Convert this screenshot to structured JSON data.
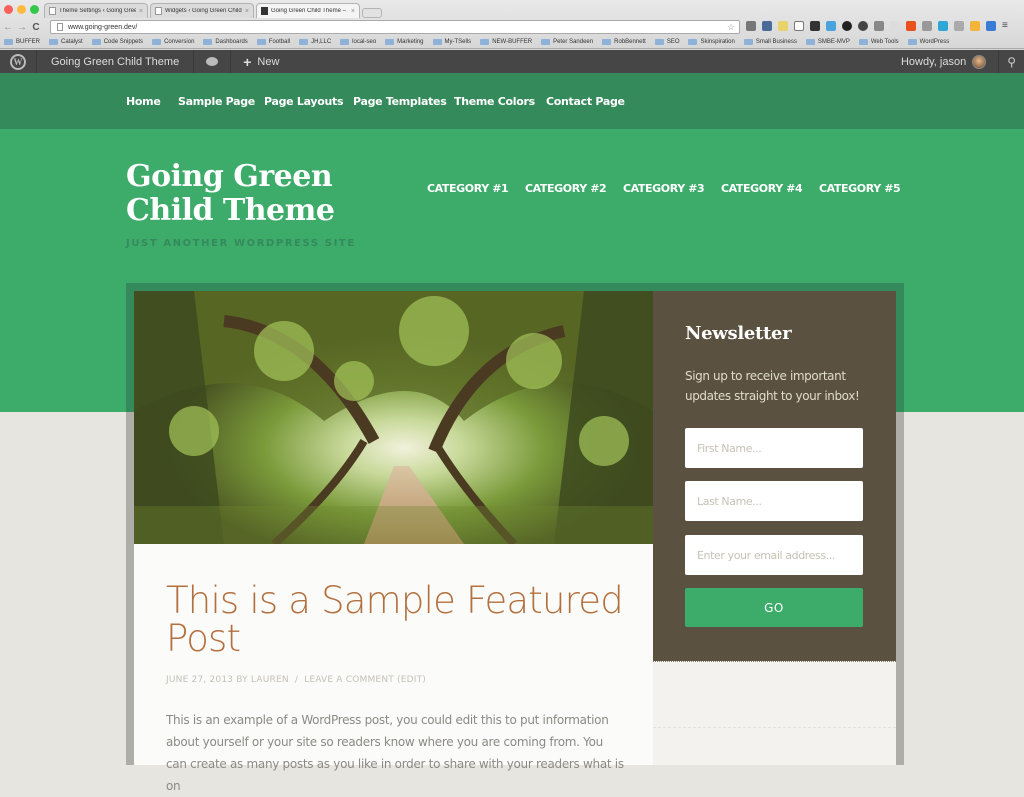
{
  "browser": {
    "tabs": [
      {
        "title": "Theme Settings ‹ Going Green",
        "active": false
      },
      {
        "title": "Widgets ‹ Going Green Child",
        "active": false
      },
      {
        "title": "Going Green Child Theme – J",
        "active": true
      }
    ],
    "url": "www.going-green.dev/",
    "bookmarks": [
      "BUFFER",
      "Catalyst",
      "Code Snippets",
      "Conversion",
      "Dashboards",
      "Football",
      "JH,LLC",
      "local-seo",
      "Marketing",
      "My-TSells",
      "NEW-BUFFER",
      "Peter Sandeen",
      "RobBennett",
      "SEO",
      "Skinspiration",
      "Small Business",
      "SMBE-MVP",
      "Web Tools",
      "WordPress"
    ],
    "extension_icons": [
      "wrench-icon",
      "weather-icon",
      "note-icon",
      "font-icon",
      "layers-icon",
      "feather-icon",
      "circle-icon",
      "gear-icon",
      "cloud-icon",
      "page-icon",
      "k-icon",
      "qr-icon",
      "m-icon",
      "sprout-icon",
      "duck-icon",
      "w-icon"
    ],
    "close_glyph": "×"
  },
  "adminbar": {
    "site_name": "Going Green Child Theme",
    "new_label": "New",
    "greeting": "Howdy, jason"
  },
  "nav": {
    "primary": [
      "Home",
      "Sample Page",
      "Page Layouts",
      "Page Templates",
      "Theme Colors",
      "Contact Page"
    ],
    "categories": [
      "CATEGORY #1",
      "CATEGORY #2",
      "CATEGORY #3",
      "CATEGORY #4",
      "CATEGORY #5"
    ]
  },
  "site": {
    "title_line1": "Going Green",
    "title_line2": "Child Theme",
    "tagline": "JUST ANOTHER WORDPRESS SITE"
  },
  "post": {
    "title": "This is a Sample Featured Post",
    "date": "JUNE 27, 2013",
    "by": "BY",
    "author": "LAUREN",
    "separator": "/",
    "comment_link": "LEAVE A COMMENT",
    "edit_link": "(EDIT)",
    "excerpt": "This is an example of a WordPress post, you could edit this to put information about yourself or your site so readers know where you are coming from. You can create as many posts as you like in order to share with your readers what is on"
  },
  "newsletter": {
    "title": "Newsletter",
    "description": "Sign up to receive important updates straight to your inbox!",
    "first_name_placeholder": "First Name...",
    "last_name_placeholder": "Last Name...",
    "email_placeholder": "Enter your email address...",
    "button_label": "GO"
  },
  "colors": {
    "primary_green": "#3dab6a",
    "dark_green": "#358a5b",
    "sidebar_brown": "#5a5140",
    "title_orange": "#b3703f"
  }
}
